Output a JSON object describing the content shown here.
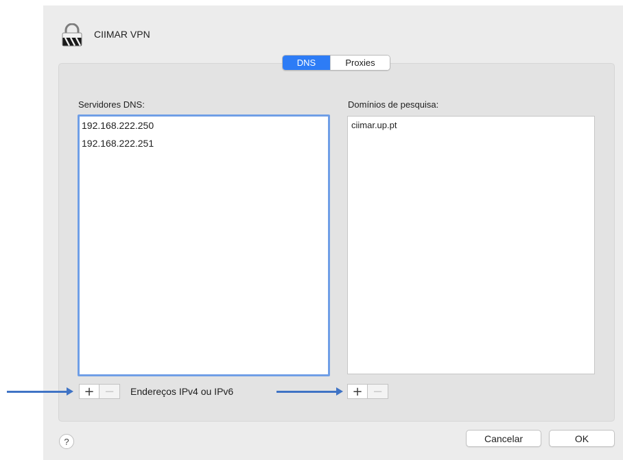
{
  "window": {
    "title": "CIIMAR VPN",
    "icon": "vpn-lock-icon"
  },
  "tabs": [
    {
      "label": "DNS",
      "active": true
    },
    {
      "label": "Proxies",
      "active": false
    }
  ],
  "dns": {
    "servers_label": "Servidores DNS:",
    "servers": [
      "192.168.222.250",
      "192.168.222.251"
    ],
    "hint": "Endereços IPv4 ou IPv6",
    "search_domains_label": "Domínios de pesquisa:",
    "search_domains": [
      "ciimar.up.pt"
    ]
  },
  "controls": {
    "add": "+",
    "remove": "−"
  },
  "footer": {
    "help": "?",
    "cancel": "Cancelar",
    "ok": "OK"
  },
  "colors": {
    "accent": "#2d7cf6",
    "focus_ring": "#6f9ee6",
    "annotation_arrow": "#3f73c5"
  }
}
